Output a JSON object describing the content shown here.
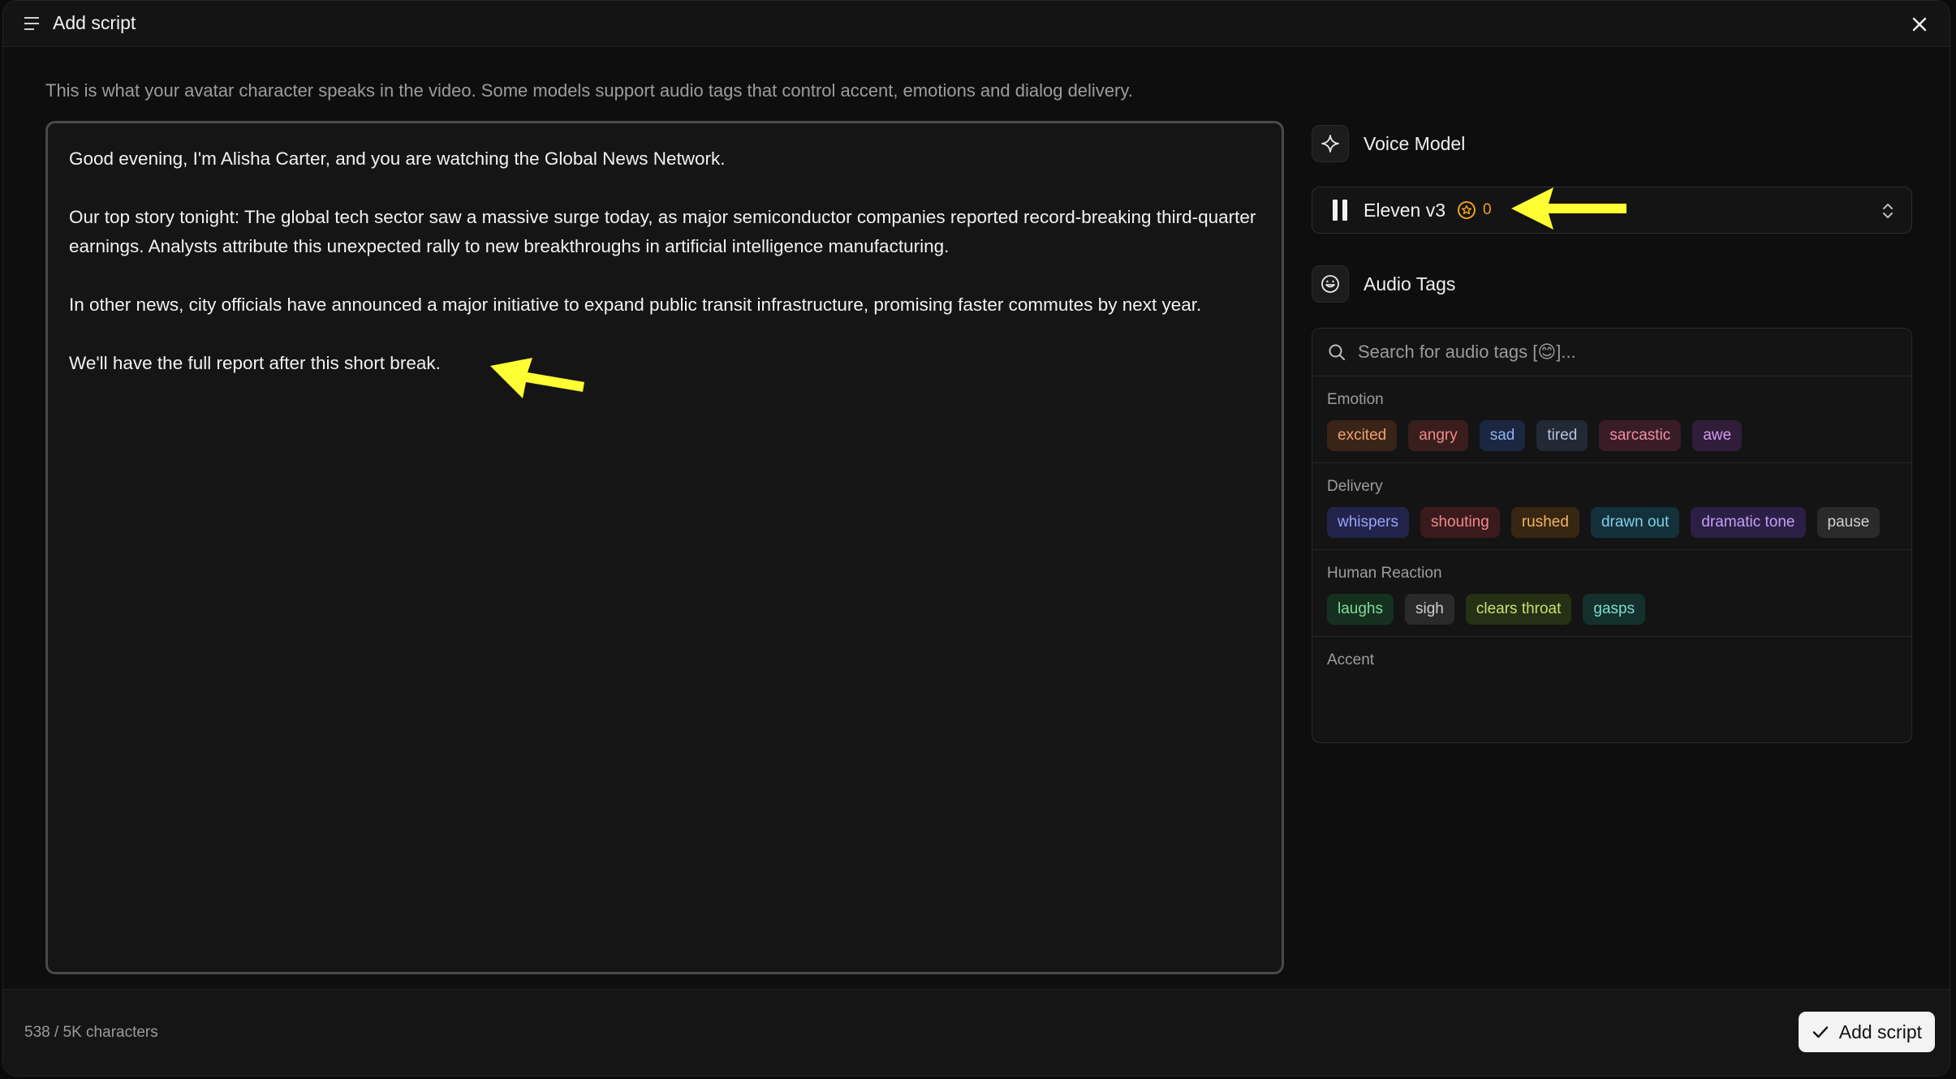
{
  "header": {
    "title": "Add script"
  },
  "description": "This is what your avatar character speaks in the video. Some models support audio tags that control accent, emotions and dialog delivery.",
  "editor": {
    "paragraphs": [
      "Good evening, I'm Alisha Carter, and you are watching the Global News Network.",
      "Our top story tonight: The global tech sector saw a massive surge today, as major semiconductor companies reported record-breaking third-quarter earnings. Analysts attribute this unexpected rally to new breakthroughs in artificial intelligence manufacturing.",
      "In other news, city officials have announced a major initiative to expand public transit infrastructure, promising faster commutes by next year.",
      "We'll have the full report after this short break."
    ]
  },
  "voice_model": {
    "heading": "Voice Model",
    "selected": "Eleven v3",
    "credits": "0",
    "credit_color": "#f0a020"
  },
  "audio_tags": {
    "heading": "Audio Tags",
    "search_placeholder": "Search for audio tags [😊]...",
    "groups": [
      {
        "title": "Emotion",
        "tags": [
          {
            "label": "excited",
            "color": "#f0a070",
            "bg": "#3a2417"
          },
          {
            "label": "angry",
            "color": "#ef8a8a",
            "bg": "#3a1d1d"
          },
          {
            "label": "sad",
            "color": "#8fb2f0",
            "bg": "#1b2640"
          },
          {
            "label": "tired",
            "color": "#b6c2d9",
            "bg": "#222834"
          },
          {
            "label": "sarcastic",
            "color": "#ee8fa6",
            "bg": "#3a1c26"
          },
          {
            "label": "awe",
            "color": "#d79cf0",
            "bg": "#2f1d3a"
          }
        ]
      },
      {
        "title": "Delivery",
        "tags": [
          {
            "label": "whispers",
            "color": "#9aa2f5",
            "bg": "#21234a"
          },
          {
            "label": "shouting",
            "color": "#f08a8a",
            "bg": "#3a1a1c"
          },
          {
            "label": "rushed",
            "color": "#f2b560",
            "bg": "#372612"
          },
          {
            "label": "drawn out",
            "color": "#7fcfe8",
            "bg": "#14303a"
          },
          {
            "label": "dramatic tone",
            "color": "#c4a0f5",
            "bg": "#2b1f45"
          },
          {
            "label": "pause",
            "color": "#d0d0d0",
            "bg": "#2a2a2a"
          }
        ]
      },
      {
        "title": "Human Reaction",
        "tags": [
          {
            "label": "laughs",
            "color": "#7fdc9a",
            "bg": "#15301f"
          },
          {
            "label": "sigh",
            "color": "#cfcfcf",
            "bg": "#2a2a2a"
          },
          {
            "label": "clears throat",
            "color": "#c8e070",
            "bg": "#263014"
          },
          {
            "label": "gasps",
            "color": "#7fdccf",
            "bg": "#14302c"
          }
        ]
      }
    ],
    "partial_group": "Accent"
  },
  "footer": {
    "char_count": "538 / 5K characters",
    "add_button": "Add script"
  },
  "annotation_color": "#ffff33"
}
